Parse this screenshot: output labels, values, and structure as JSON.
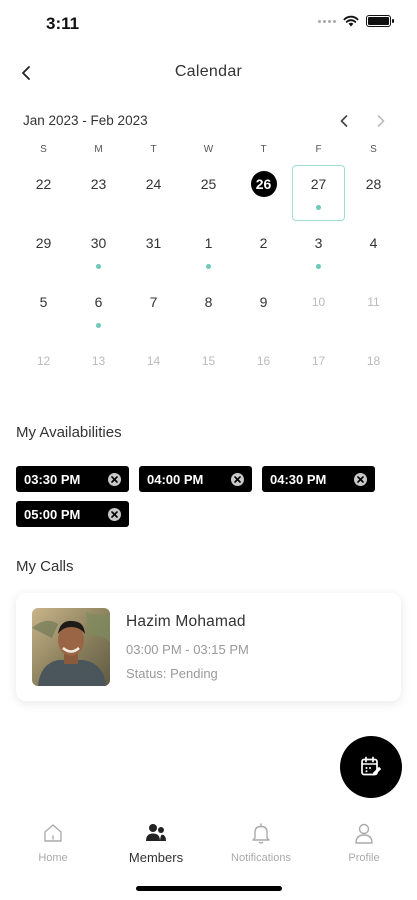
{
  "status_bar": {
    "time": "3:11"
  },
  "header": {
    "title": "Calendar"
  },
  "calendar": {
    "range_label": "Jan 2023 - Feb 2023",
    "weekdays": [
      "S",
      "M",
      "T",
      "W",
      "T",
      "F",
      "S"
    ],
    "weeks": [
      [
        "22",
        "23",
        "24",
        "25",
        "26",
        "27",
        "28"
      ],
      [
        "29",
        "30",
        "31",
        "1",
        "2",
        "3",
        "4"
      ],
      [
        "5",
        "6",
        "7",
        "8",
        "9",
        "10",
        "11"
      ],
      [
        "12",
        "13",
        "14",
        "15",
        "16",
        "17",
        "18"
      ]
    ],
    "today": "26",
    "selected": "27",
    "days_with_events": [
      "27",
      "30",
      "1",
      "3",
      "6"
    ]
  },
  "availabilities": {
    "title": "My Availabilities",
    "slots": [
      "03:30 PM",
      "04:00 PM",
      "04:30 PM",
      "05:00 PM"
    ]
  },
  "calls": {
    "title": "My Calls",
    "items": [
      {
        "name": "Hazim Mohamad",
        "time": "03:00 PM - 03:15 PM",
        "status": "Status: Pending"
      }
    ]
  },
  "tabs": [
    {
      "label": "Home",
      "icon": "home-icon",
      "active": false
    },
    {
      "label": "Members",
      "icon": "members-icon",
      "active": true
    },
    {
      "label": "Notifications",
      "icon": "bell-icon",
      "active": false
    },
    {
      "label": "Profile",
      "icon": "user-icon",
      "active": false
    }
  ],
  "colors": {
    "accent_teal": "#6cc9b7",
    "selected_border": "#9edfd5",
    "primary": "#000000"
  }
}
